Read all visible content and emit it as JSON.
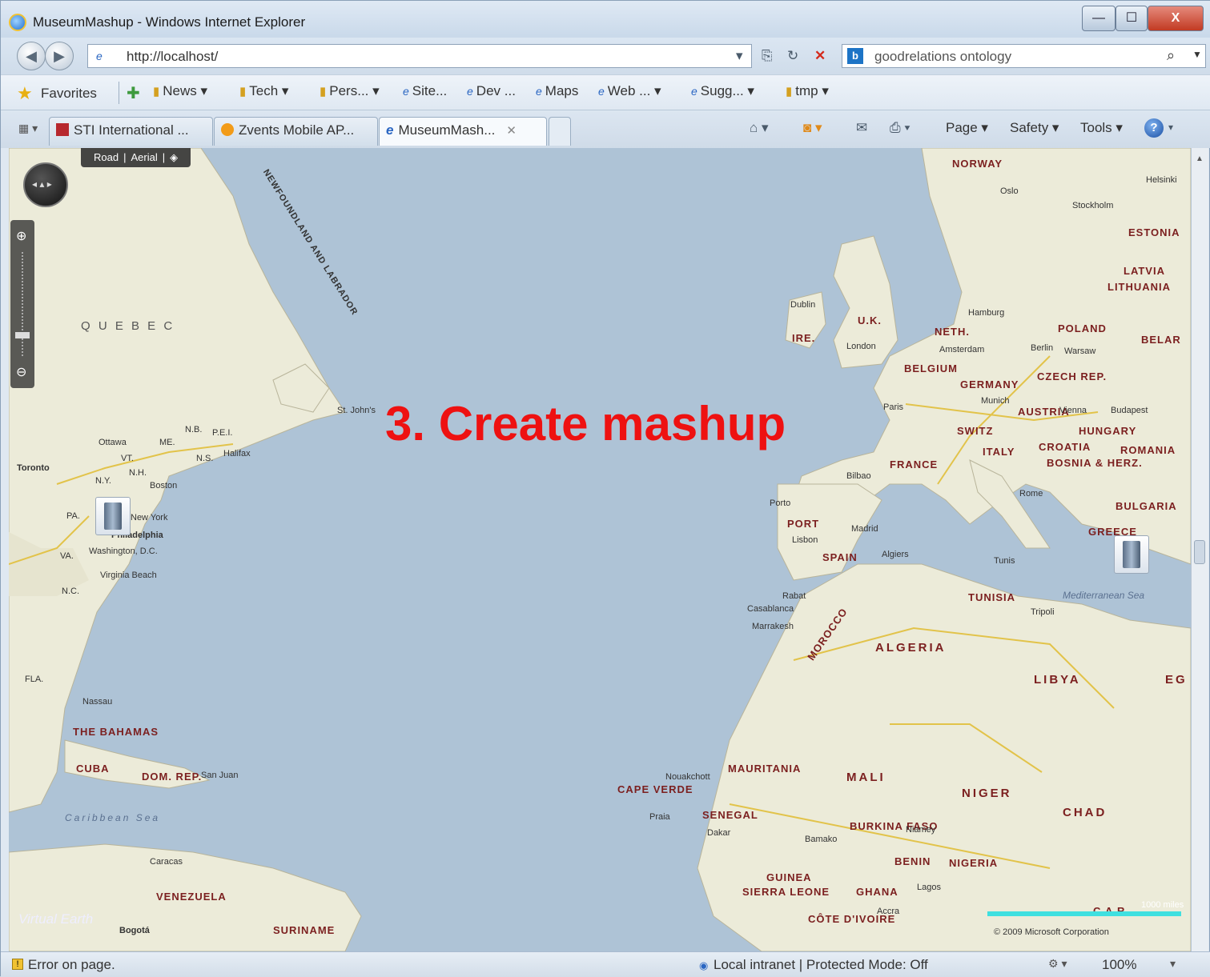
{
  "window": {
    "title": "MuseumMashup - Windows Internet Explorer",
    "min_glyph": "—",
    "max_glyph": "☐",
    "close_glyph": "X"
  },
  "navbar": {
    "url": "http://localhost/",
    "search_query": "goodrelations ontology"
  },
  "favorites": {
    "label": "Favorites",
    "items": [
      {
        "label": "News ▾",
        "kind": "folder"
      },
      {
        "label": "Tech ▾",
        "kind": "folder"
      },
      {
        "label": "Pers... ▾",
        "kind": "folder"
      },
      {
        "label": "Site...",
        "kind": "page"
      },
      {
        "label": "Dev ...",
        "kind": "page"
      },
      {
        "label": "Maps",
        "kind": "page"
      },
      {
        "label": "Web ... ▾",
        "kind": "page"
      },
      {
        "label": "Sugg... ▾",
        "kind": "page"
      },
      {
        "label": "tmp ▾",
        "kind": "folder"
      }
    ]
  },
  "tabs": [
    {
      "label": "STI International ...",
      "active": false
    },
    {
      "label": "Zvents Mobile AP...",
      "active": false
    },
    {
      "label": "MuseumMash...",
      "active": true
    }
  ],
  "commands": {
    "page": "Page ▾",
    "safety": "Safety ▾",
    "tools": "Tools ▾",
    "help": "?"
  },
  "map": {
    "style_road": "Road",
    "style_aerial": "Aerial",
    "overlay_title": "3.   Create mashup",
    "scale_label": "1000 miles",
    "copyright": "© 2009 Microsoft Corporation",
    "logo_text": "Virtual Earth",
    "countries": {
      "norway": "NORWAY",
      "uk": "U.K.",
      "ire": "IRE.",
      "poland": "POLAND",
      "belar": "BELAR",
      "latvia": "LATVIA",
      "lithuania": "LITHUANIA",
      "estonia": "ESTONIA",
      "neth": "NETH.",
      "belgium": "BELGIUM",
      "germany": "GERMANY",
      "czech": "CZECH REP.",
      "austria": "AUSTRIA",
      "hungary": "HUNGARY",
      "switz": "SWITZ",
      "france": "FRANCE",
      "italy": "ITALY",
      "croatia": "CROATIA",
      "bosnia": "BOSNIA & HERZ.",
      "romania": "ROMANIA",
      "bulgaria": "BULGARIA",
      "greece": "GREECE",
      "port": "PORT",
      "spain": "SPAIN",
      "tunisia": "TUNISIA",
      "morocco": "MOROCCO",
      "algeria": "ALGERIA",
      "libya": "LIBYA",
      "eg": "EG",
      "mauritania": "MAURITANIA",
      "mali": "MALI",
      "niger": "NIGER",
      "chad": "CHAD",
      "senegal": "SENEGAL",
      "burkina": "BURKINA FASO",
      "benin": "BENIN",
      "nigeria": "NIGERIA",
      "guinea": "GUINEA",
      "sierra": "SIERRA LEONE",
      "ghana": "GHANA",
      "cote": "CÔTE D'IVOIRE",
      "cape_verde": "CAPE VERDE",
      "car": "C.A.R.",
      "quebec": "Q U E B E C",
      "bahamas": "THE BAHAMAS",
      "cuba": "CUBA",
      "dom_rep": "DOM. REP.",
      "venezuela": "VENEZUELA",
      "suriname": "SURINAME"
    },
    "cities": {
      "oslo": "Oslo",
      "stockholm": "Stockholm",
      "helsinki": "Helsinki",
      "dublin": "Dublin",
      "london": "London",
      "amsterdam": "Amsterdam",
      "hamburg": "Hamburg",
      "berlin": "Berlin",
      "warsaw": "Warsaw",
      "paris": "Paris",
      "munich": "Munich",
      "vienna": "Vienna",
      "budapest": "Budapest",
      "rome": "Rome",
      "madrid": "Madrid",
      "lisbon": "Lisbon",
      "porto": "Porto",
      "bilbao": "Bilbao",
      "algiers": "Algiers",
      "tunis": "Tunis",
      "tripoli": "Tripoli",
      "rabat": "Rabat",
      "casablanca": "Casablanca",
      "marrakesh": "Marrakesh",
      "dakar": "Dakar",
      "nouakchott": "Nouakchott",
      "bamako": "Bamako",
      "niamey": "Niamey",
      "accra": "Accra",
      "lagos": "Lagos",
      "st_johns": "St. John's",
      "halifax": "Halifax",
      "ottawa": "Ottawa",
      "toronto": "Toronto",
      "boston": "Boston",
      "new_york": "New York",
      "philadelphia": "Philadelphia",
      "washington": "Washington, D.C.",
      "virginia_beach": "Virginia Beach",
      "nassau": "Nassau",
      "san_juan": "San Juan",
      "caracas": "Caracas",
      "bogota": "Bogotá",
      "praia": "Praia"
    },
    "seas": {
      "caribbean": "Caribbean Sea",
      "mediterranean": "Mediterranean Sea"
    },
    "region_labels": {
      "newfoundland": "NEWFOUNDLAND AND LABRADOR",
      "nb": "N.B.",
      "pei": "P.E.I.",
      "ns": "N.S.",
      "me": "ME.",
      "vt": "VT.",
      "nh": "N.H.",
      "ny": "N.Y.",
      "pa": "PA.",
      "va": "VA.",
      "nc": "N.C.",
      "fla": "FLA."
    }
  },
  "status": {
    "text": "Error on page.",
    "zone": "Local intranet | Protected Mode: Off",
    "zoom": "100%"
  }
}
